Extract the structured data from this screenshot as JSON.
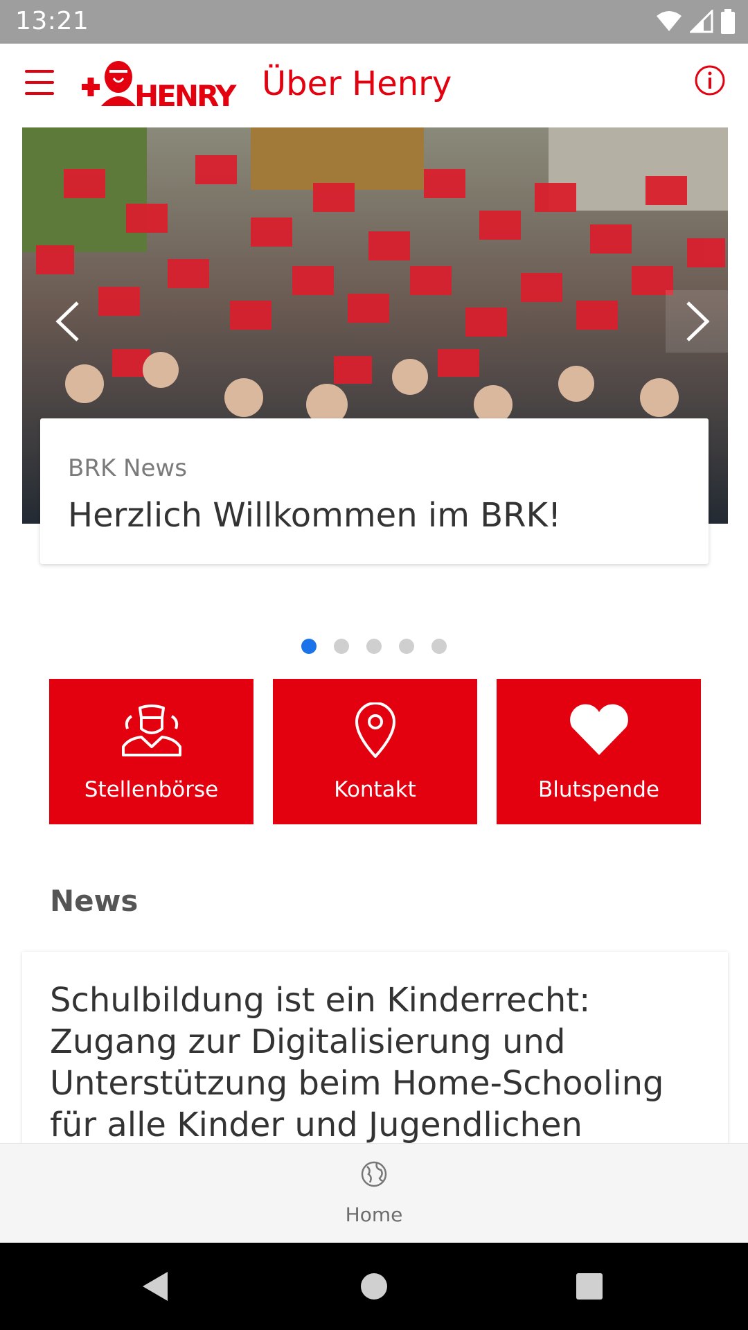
{
  "status_bar": {
    "time": "13:21"
  },
  "app_bar": {
    "title": "Über Henry",
    "logo_text": "HENRY"
  },
  "carousel": {
    "news_card": {
      "source": "BRK News",
      "title": "Herzlich Willkommen im BRK!"
    },
    "dots": {
      "count": 5,
      "active_index": 0
    }
  },
  "tiles": [
    {
      "label": "Stellenbörse",
      "icon": "staff-icon"
    },
    {
      "label": "Kontakt",
      "icon": "location-pin-icon"
    },
    {
      "label": "Blutspende",
      "icon": "heart-icon"
    }
  ],
  "news": {
    "section_title": "News",
    "article_title": "Schulbildung ist ein Kinderrecht: Zugang zur Digitalisierung und Unterstützung beim Home-Schooling für alle Kinder und Jugendlichen"
  },
  "bottom_nav": {
    "home_label": "Home",
    "icon": "globe-icon"
  },
  "colors": {
    "brand_red": "#e3000f",
    "active_dot": "#1a73e8",
    "status_bar": "#9e9e9e"
  }
}
